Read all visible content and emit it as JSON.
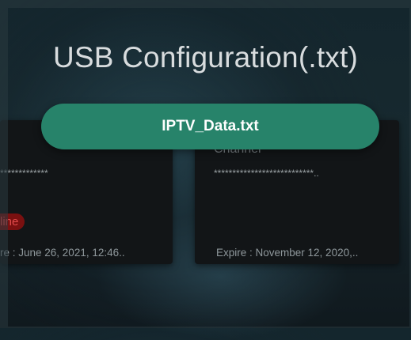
{
  "dialog": {
    "title": "USB Configuration(.txt)",
    "file_button_label": "IPTV_Data.txt"
  },
  "background_cards": [
    {
      "password_mask": "*************",
      "status_badge": "line",
      "expire_text": "re : June 26, 2021, 12:46.."
    },
    {
      "title_partial": "Channel",
      "password_mask": "***************************..",
      "expire_text": "Expire : November 12, 2020,.."
    }
  ],
  "colors": {
    "button": "#27836a",
    "badge_bg": "#7a1010",
    "badge_text": "#e24a4a",
    "card_bg": "#121517"
  }
}
